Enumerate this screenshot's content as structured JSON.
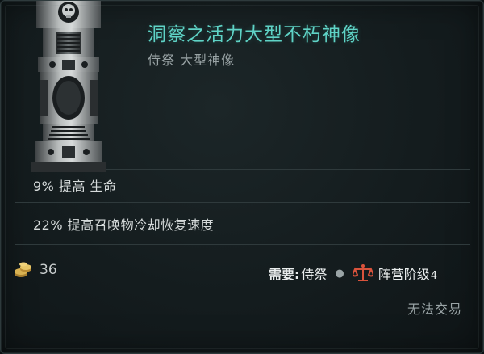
{
  "item": {
    "title": "洞察之活力大型不朽神像",
    "subtitle": "侍祭 大型神像",
    "image_icon": "statue-icon"
  },
  "stats": [
    "9% 提高 生命",
    "22% 提高召唤物冷却恢复速度"
  ],
  "footer": {
    "price_icon": "gold-icon",
    "price": "36",
    "requirement_label": "需要:",
    "requirement_value": "侍祭",
    "faction_icon": "scales-icon",
    "faction_label": "阵营阶级",
    "faction_tier": "4",
    "trade_status": "无法交易"
  },
  "colors": {
    "title": "#5fd3c6",
    "subtitle": "#9aa4a6",
    "stat_text": "#d6dbdb",
    "faction_icon": "#d9533c",
    "gold": "#d9b252",
    "background": "#141c1e"
  }
}
